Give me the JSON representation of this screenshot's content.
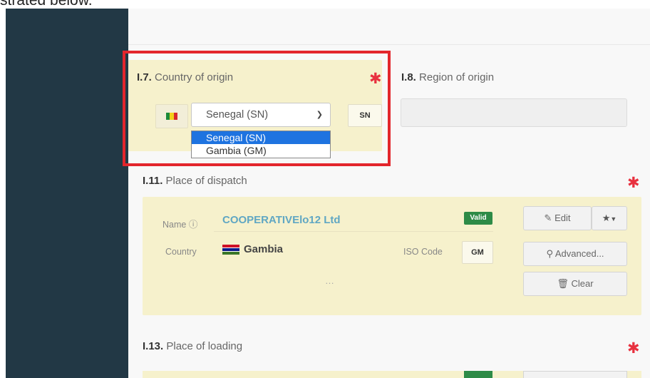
{
  "cropped_caption": "strated below.",
  "country_of_origin": {
    "number": "I.7.",
    "label": " Country of origin",
    "selected": "Senegal (SN)",
    "code": "SN",
    "options": [
      "Senegal (SN)",
      "Gambia (GM)"
    ]
  },
  "region_of_origin": {
    "number": "I.8.",
    "label": " Region of origin",
    "value": ""
  },
  "place_of_dispatch": {
    "number": "I.11.",
    "label": " Place of dispatch",
    "name_label": "Name ⓘ",
    "name_value": "COOPERATIVElo12 Ltd",
    "status_badge": "Valid",
    "country_label": "Country",
    "country_value": "Gambia",
    "iso_label": "ISO Code",
    "iso_value": "GM",
    "more": "…",
    "edit_button": "Edit",
    "advanced_button": "Advanced...",
    "clear_button": "Clear"
  },
  "place_of_loading": {
    "number": "I.13.",
    "label": " Place of loading"
  },
  "required_mark": "✱",
  "colors": {
    "sidebar": "#223845",
    "panel": "#f6f1cc",
    "highlight": "#e3262c",
    "valid": "#2e8b47",
    "link": "#60a7c3",
    "select_highlight": "#1e73e0"
  },
  "icons": {
    "edit": "edit-icon",
    "favorite": "star-icon",
    "search": "search-icon",
    "clear": "trash-icon",
    "flag_sn": "senegal-flag-icon",
    "flag_gm": "gambia-flag-icon",
    "info": "info-icon"
  }
}
